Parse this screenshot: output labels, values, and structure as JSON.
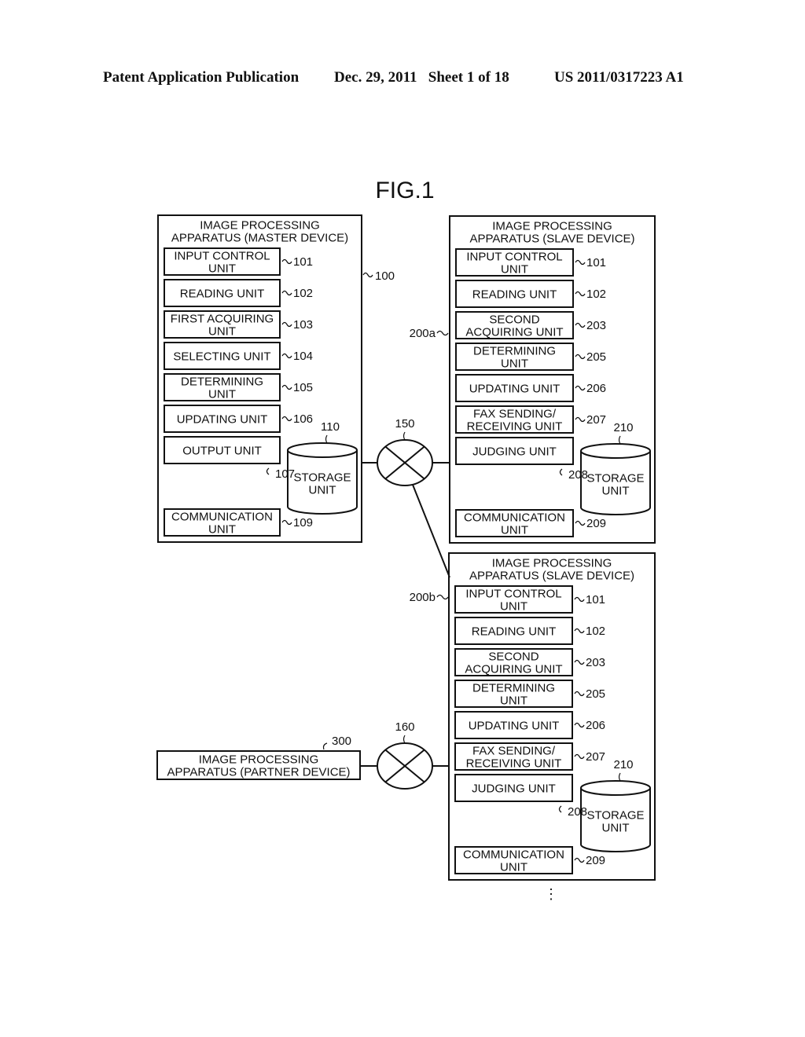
{
  "header": {
    "publication": "Patent Application Publication",
    "date_sheet": "Dec. 29, 2011   Sheet 1 of 18",
    "number": "US 2011/0317223 A1"
  },
  "figure": {
    "title": "FIG.1",
    "master": {
      "ref": "100",
      "title": [
        "IMAGE PROCESSING",
        "APPARATUS (MASTER DEVICE)"
      ],
      "units": [
        {
          "lines": [
            "INPUT CONTROL",
            "UNIT"
          ],
          "ref": "101"
        },
        {
          "lines": [
            "READING UNIT"
          ],
          "ref": "102"
        },
        {
          "lines": [
            "FIRST ACQUIRING",
            "UNIT"
          ],
          "ref": "103"
        },
        {
          "lines": [
            "SELECTING UNIT"
          ],
          "ref": "104"
        },
        {
          "lines": [
            "DETERMINING",
            "UNIT"
          ],
          "ref": "105"
        },
        {
          "lines": [
            "UPDATING UNIT"
          ],
          "ref": "106"
        },
        {
          "lines": [
            "OUTPUT UNIT"
          ],
          "ref": "107"
        }
      ],
      "comm": {
        "lines": [
          "COMMUNICATION",
          "UNIT"
        ],
        "ref": "109"
      },
      "storage": {
        "lines": [
          "STORAGE",
          "UNIT"
        ],
        "ref": "110"
      }
    },
    "slaves": [
      {
        "ref": "200a",
        "title": [
          "IMAGE PROCESSING",
          "APPARATUS (SLAVE DEVICE)"
        ],
        "units": [
          {
            "lines": [
              "INPUT CONTROL",
              "UNIT"
            ],
            "ref": "101"
          },
          {
            "lines": [
              "READING UNIT"
            ],
            "ref": "102"
          },
          {
            "lines": [
              "SECOND",
              "ACQUIRING UNIT"
            ],
            "ref": "203"
          },
          {
            "lines": [
              "DETERMINING",
              "UNIT"
            ],
            "ref": "205"
          },
          {
            "lines": [
              "UPDATING UNIT"
            ],
            "ref": "206"
          },
          {
            "lines": [
              "FAX SENDING/",
              "RECEIVING UNIT"
            ],
            "ref": "207"
          },
          {
            "lines": [
              "JUDGING UNIT"
            ],
            "ref": "208"
          }
        ],
        "comm": {
          "lines": [
            "COMMUNICATION",
            "UNIT"
          ],
          "ref": "209"
        },
        "storage": {
          "lines": [
            "STORAGE",
            "UNIT"
          ],
          "ref": "210"
        }
      },
      {
        "ref": "200b",
        "title": [
          "IMAGE PROCESSING",
          "APPARATUS (SLAVE DEVICE)"
        ],
        "units": [
          {
            "lines": [
              "INPUT CONTROL",
              "UNIT"
            ],
            "ref": "101"
          },
          {
            "lines": [
              "READING UNIT"
            ],
            "ref": "102"
          },
          {
            "lines": [
              "SECOND",
              "ACQUIRING UNIT"
            ],
            "ref": "203"
          },
          {
            "lines": [
              "DETERMINING",
              "UNIT"
            ],
            "ref": "205"
          },
          {
            "lines": [
              "UPDATING UNIT"
            ],
            "ref": "206"
          },
          {
            "lines": [
              "FAX SENDING/",
              "RECEIVING UNIT"
            ],
            "ref": "207"
          },
          {
            "lines": [
              "JUDGING UNIT"
            ],
            "ref": "208"
          }
        ],
        "comm": {
          "lines": [
            "COMMUNICATION",
            "UNIT"
          ],
          "ref": "209"
        },
        "storage": {
          "lines": [
            "STORAGE",
            "UNIT"
          ],
          "ref": "210"
        }
      }
    ],
    "partner": {
      "ref": "300",
      "lines": [
        "IMAGE PROCESSING",
        "APPARATUS (PARTNER DEVICE)"
      ]
    },
    "networks": [
      {
        "ref": "150"
      },
      {
        "ref": "160"
      }
    ],
    "continuation": "⋮"
  }
}
